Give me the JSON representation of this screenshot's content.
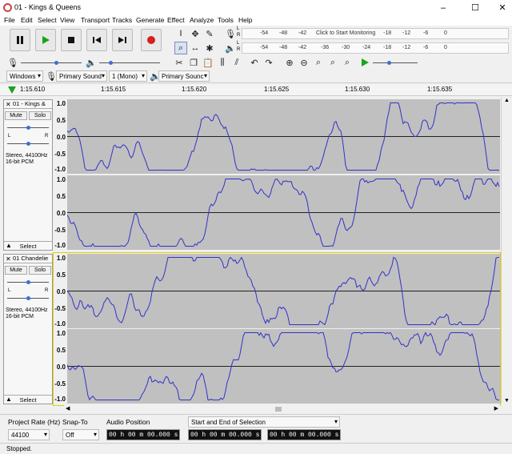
{
  "window": {
    "title": "01 - Kings & Queens",
    "minimize": "–",
    "maximize": "☐",
    "close": "✕"
  },
  "menu": [
    "File",
    "Edit",
    "Select",
    "View",
    "Transport",
    "Tracks",
    "Generate",
    "Effect",
    "Analyze",
    "Tools",
    "Help"
  ],
  "meters": {
    "record_ticks": [
      "-54",
      "-48",
      "-42",
      "Click to Start Monitoring",
      "-18",
      "-12",
      "-6",
      "0"
    ],
    "play_ticks": [
      "-54",
      "-48",
      "-42",
      "-36",
      "-30",
      "-24",
      "-18",
      "-12",
      "-6",
      "0"
    ],
    "record_letters": [
      "L",
      "R"
    ],
    "play_letters": [
      "L",
      "R"
    ]
  },
  "device": {
    "host": "Windows",
    "recording_device": "Primary Sound",
    "channels": "1 (Mono)",
    "playback_device": "Primary Sounc"
  },
  "ruler": {
    "ticks": [
      "1:15.610",
      "1:15.615",
      "1:15.620",
      "1:15.625",
      "1:15.630",
      "1:15.635"
    ]
  },
  "tracks": [
    {
      "name": "01 - Kings &",
      "mute": "Mute",
      "solo": "Solo",
      "gain_letters": [
        "L",
        "R"
      ],
      "info1": "Stereo, 44100Hz",
      "info2": "16-bit PCM",
      "select": "Select",
      "scale": [
        "1.0",
        "0.5",
        "0.0",
        "-0.5",
        "-1.0"
      ],
      "selected": false
    },
    {
      "name": "01 Chandelie",
      "mute": "Mute",
      "solo": "Solo",
      "gain_letters": [
        "L",
        "R"
      ],
      "info1": "Stereo, 44100Hz",
      "info2": "16-bit PCM",
      "select": "Select",
      "scale": [
        "1.0",
        "0.5",
        "0.0",
        "-0.5",
        "-1.0"
      ],
      "selected": true
    }
  ],
  "selection_toolbar": {
    "project_rate_label": "Project Rate (Hz)",
    "project_rate_value": "44100",
    "snap_to_label": "Snap-To",
    "snap_to_value": "Off",
    "audio_position_label": "Audio Position",
    "audio_position_value": "00 h 00 m 00.000 s",
    "selection_mode": "Start and End of Selection",
    "selection_start": "00 h 00 m 00.000 s",
    "selection_end": "00 h 00 m 00.000 s"
  },
  "status": "Stopped.",
  "colors": {
    "wave": "#3232c8",
    "wave_bg": "#c0c0c0",
    "record": "#d42020",
    "play": "#1aa31a",
    "selected_border": "#e0d000"
  }
}
